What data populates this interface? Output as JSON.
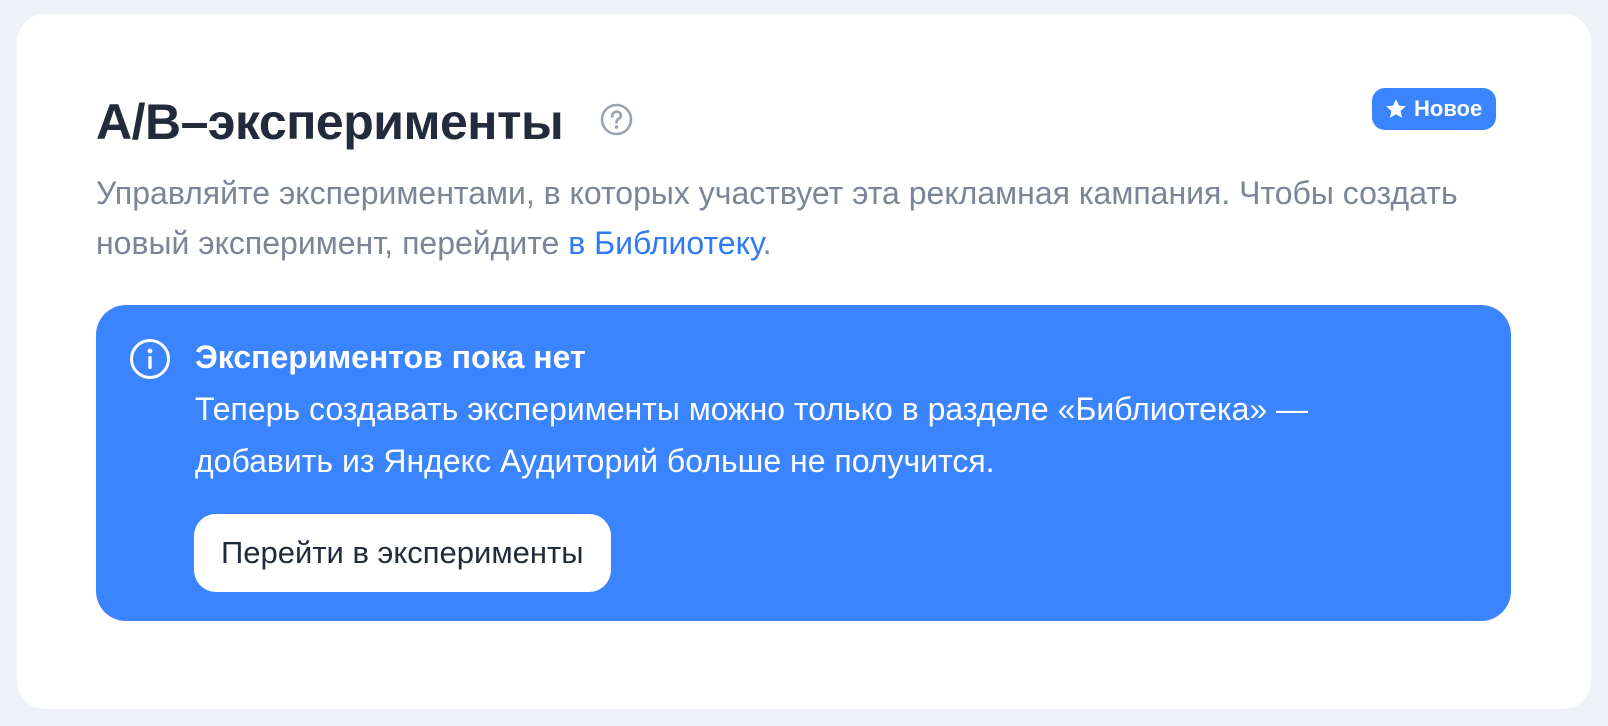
{
  "section": {
    "title": "A/B–эксперименты",
    "help_icon": "question-circle-icon",
    "badge": {
      "icon": "star-icon",
      "label": "Новое"
    },
    "description_before_link": "Управляйте экспериментами, в которых участвует эта рекламная кампания. Чтобы создать новый эксперимент, перейдите ",
    "description_link": "в Библиотеку",
    "description_after_link": "."
  },
  "banner": {
    "icon": "info-circle-icon",
    "title": "Экспериментов пока нет",
    "text": "Теперь создавать эксперименты можно только в разделе «Библиотека» — добавить из Яндекс Аудиторий больше не получится.",
    "button_label": "Перейти в эксперименты"
  },
  "colors": {
    "page_background": "#eef1f5",
    "card_background": "#ffffff",
    "accent": "#3a84ff",
    "link": "#2f7bf5",
    "title_text": "#222b3b",
    "secondary_text": "#7b8597"
  }
}
